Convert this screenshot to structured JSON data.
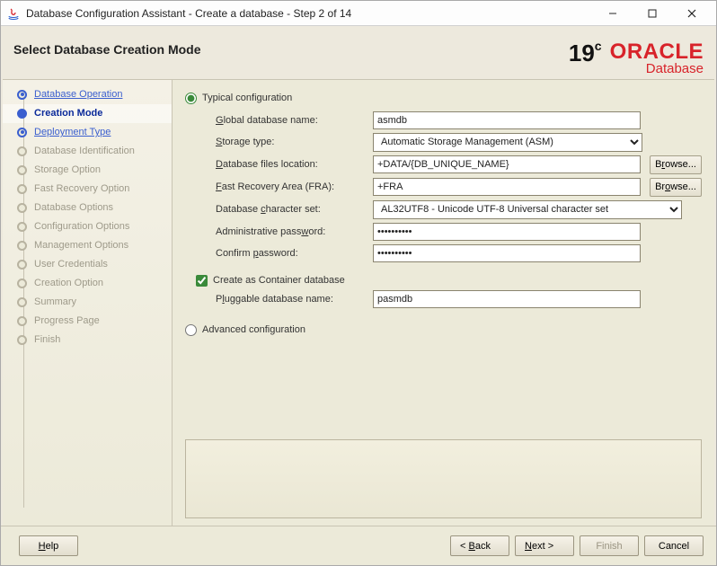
{
  "window": {
    "title": "Database Configuration Assistant - Create a database - Step 2 of 14"
  },
  "header": {
    "heading": "Select Database Creation Mode",
    "version": "19",
    "version_sup": "c",
    "brand_top": "ORACLE",
    "brand_bottom": "Database"
  },
  "sidebar": {
    "items": [
      {
        "label": "Database Operation",
        "state": "done"
      },
      {
        "label": "Creation Mode",
        "state": "current"
      },
      {
        "label": "Deployment Type",
        "state": "done"
      },
      {
        "label": "Database Identification",
        "state": "future"
      },
      {
        "label": "Storage Option",
        "state": "future"
      },
      {
        "label": "Fast Recovery Option",
        "state": "future"
      },
      {
        "label": "Database Options",
        "state": "future"
      },
      {
        "label": "Configuration Options",
        "state": "future"
      },
      {
        "label": "Management Options",
        "state": "future"
      },
      {
        "label": "User Credentials",
        "state": "future"
      },
      {
        "label": "Creation Option",
        "state": "future"
      },
      {
        "label": "Summary",
        "state": "future"
      },
      {
        "label": "Progress Page",
        "state": "future"
      },
      {
        "label": "Finish",
        "state": "future"
      }
    ]
  },
  "form": {
    "typical_label": "Typical configuration",
    "advanced_label": "Advanced configuration",
    "global_db_label": "Global database name:",
    "global_db_value": "asmdb",
    "storage_type_label": "Storage type:",
    "storage_type_value": "Automatic Storage Management (ASM)",
    "files_loc_label": "Database files location:",
    "files_loc_value": "+DATA/{DB_UNIQUE_NAME}",
    "fra_label": "Fast Recovery Area (FRA):",
    "fra_value": "+FRA",
    "charset_label": "Database character set:",
    "charset_value": "AL32UTF8 - Unicode UTF-8 Universal character set",
    "admin_pw_label": "Administrative password:",
    "admin_pw_value": "●●●●●●●●●●",
    "confirm_pw_label": "Confirm password:",
    "confirm_pw_value": "●●●●●●●●●●",
    "container_label": "Create as Container database",
    "pdb_label": "Pluggable database name:",
    "pdb_value": "pasmdb",
    "browse_label": "Browse..."
  },
  "footer": {
    "help": "Help",
    "back_pre": "< ",
    "back": "Back",
    "next": "Next",
    "next_post": " >",
    "finish": "Finish",
    "cancel": "Cancel"
  }
}
